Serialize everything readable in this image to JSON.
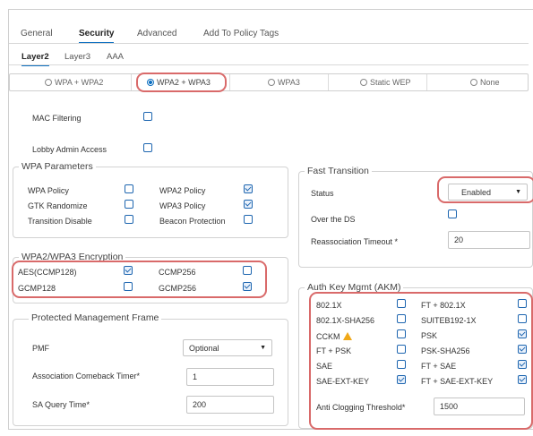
{
  "tabs": [
    "General",
    "Security",
    "Advanced",
    "Add To Policy Tags"
  ],
  "subtabs": [
    "Layer2",
    "Layer3",
    "AAA"
  ],
  "security_modes": {
    "options": [
      "WPA + WPA2",
      "WPA2 + WPA3",
      "WPA3",
      "Static WEP",
      "None"
    ],
    "selected": "WPA2 + WPA3"
  },
  "mac_filtering_label": "MAC Filtering",
  "lobby_admin_label": "Lobby Admin Access",
  "wpa_params": {
    "legend": "WPA Parameters",
    "items": [
      {
        "label": "WPA Policy",
        "checked": false
      },
      {
        "label": "WPA2 Policy",
        "checked": true
      },
      {
        "label": "GTK Randomize",
        "checked": false
      },
      {
        "label": "WPA3 Policy",
        "checked": true
      },
      {
        "label": "Transition Disable",
        "checked": false
      },
      {
        "label": "Beacon Protection",
        "checked": false
      }
    ]
  },
  "encryption": {
    "legend": "WPA2/WPA3 Encryption",
    "items": [
      {
        "label": "AES(CCMP128)",
        "checked": true
      },
      {
        "label": "CCMP256",
        "checked": false
      },
      {
        "label": "GCMP128",
        "checked": false
      },
      {
        "label": "GCMP256",
        "checked": true
      }
    ]
  },
  "pmf": {
    "legend": "Protected Management Frame",
    "pmf_label": "PMF",
    "pmf_value": "Optional",
    "comeback_label": "Association Comeback Timer*",
    "comeback_value": "1",
    "sa_label": "SA Query Time*",
    "sa_value": "200"
  },
  "fast_transition": {
    "legend": "Fast Transition",
    "status_label": "Status",
    "status_value": "Enabled",
    "over_ds_label": "Over the DS",
    "reassoc_label": "Reassociation Timeout *",
    "reassoc_value": "20"
  },
  "akm": {
    "legend": "Auth Key Mgmt (AKM)",
    "items": [
      {
        "label": "802.1X",
        "checked": false
      },
      {
        "label": "FT + 802.1X",
        "checked": false
      },
      {
        "label": "802.1X-SHA256",
        "checked": false
      },
      {
        "label": "SUITEB192-1X",
        "checked": false
      },
      {
        "label": "CCKM",
        "checked": false,
        "warning": true
      },
      {
        "label": "PSK",
        "checked": true
      },
      {
        "label": "FT + PSK",
        "checked": false
      },
      {
        "label": "PSK-SHA256",
        "checked": true
      },
      {
        "label": "SAE",
        "checked": false
      },
      {
        "label": "FT + SAE",
        "checked": true
      },
      {
        "label": "SAE-EXT-KEY",
        "checked": true
      },
      {
        "label": "FT + SAE-EXT-KEY",
        "checked": true
      }
    ],
    "anti_clog_label": "Anti Clogging Threshold*",
    "anti_clog_value": "1500"
  },
  "colors": {
    "accent": "#0d6fc0",
    "highlight": "#d96a6a",
    "checkbox": "#1e66b0"
  }
}
